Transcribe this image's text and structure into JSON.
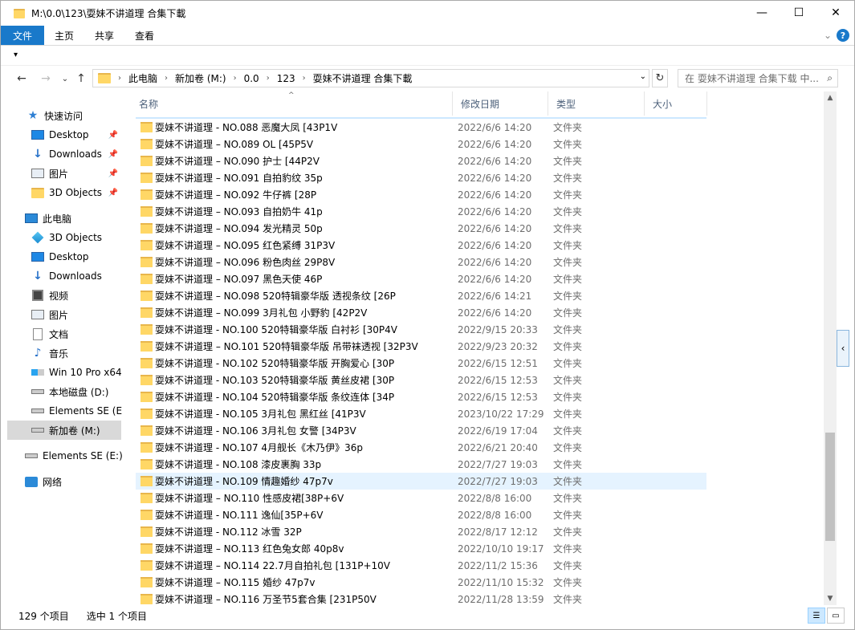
{
  "window": {
    "title": "M:\\0.0\\123\\耍妹不讲道理 合集下載",
    "minimize": "—",
    "maximize": "☐",
    "close": "✕"
  },
  "ribbon": {
    "tabs": [
      "文件",
      "主页",
      "共享",
      "查看"
    ],
    "expand": "⌄",
    "help": "?"
  },
  "qat": {
    "dropdown": "▾"
  },
  "address": {
    "crumbs": [
      "此电脑",
      "新加卷 (M:)",
      "0.0",
      "123",
      "耍妹不讲道理 合集下載"
    ],
    "search_placeholder": "在 耍妹不讲道理 合集下载 中..."
  },
  "nav": {
    "items": [
      {
        "label": "快速访问",
        "icon": "star-icon"
      },
      {
        "label": "Desktop",
        "icon": "desktop-icon",
        "pinned": true
      },
      {
        "label": "Downloads",
        "icon": "downloads-icon",
        "pinned": true
      },
      {
        "label": "图片",
        "icon": "pictures-icon",
        "pinned": true
      },
      {
        "label": "3D Objects",
        "icon": "folder-icon",
        "pinned": true
      },
      {
        "label": "此电脑",
        "icon": "this-pc-icon"
      },
      {
        "label": "3D Objects",
        "icon": "objects-3d-icon"
      },
      {
        "label": "Desktop",
        "icon": "desktop-icon"
      },
      {
        "label": "Downloads",
        "icon": "downloads-icon"
      },
      {
        "label": "视频",
        "icon": "videos-icon"
      },
      {
        "label": "图片",
        "icon": "pictures-icon"
      },
      {
        "label": "文档",
        "icon": "documents-icon"
      },
      {
        "label": "音乐",
        "icon": "music-icon"
      },
      {
        "label": "Win 10 Pro x64",
        "icon": "windows-drive-icon"
      },
      {
        "label": "本地磁盘 (D:)",
        "icon": "drive-icon"
      },
      {
        "label": "Elements SE (E:",
        "icon": "drive-icon"
      },
      {
        "label": "新加卷 (M:)",
        "icon": "drive-icon",
        "selected": true
      },
      {
        "label": "Elements SE (E:)",
        "icon": "drive-icon"
      },
      {
        "label": "网络",
        "icon": "network-icon"
      }
    ]
  },
  "columns": [
    "名称",
    "修改日期",
    "类型",
    "大小"
  ],
  "files": [
    {
      "name": "耍妹不讲道理 - NO.088 恶魔大凤 [43P1V",
      "date": "2022/6/6 14:20",
      "type": "文件夹"
    },
    {
      "name": "耍妹不讲道理 – NO.089 OL [45P5V",
      "date": "2022/6/6 14:20",
      "type": "文件夹"
    },
    {
      "name": "耍妹不讲道理 – NO.090 护士 [44P2V",
      "date": "2022/6/6 14:20",
      "type": "文件夹"
    },
    {
      "name": "耍妹不讲道理 – NO.091 自拍豹纹 35p",
      "date": "2022/6/6 14:20",
      "type": "文件夹"
    },
    {
      "name": "耍妹不讲道理 – NO.092 牛仔裤 [28P",
      "date": "2022/6/6 14:20",
      "type": "文件夹"
    },
    {
      "name": "耍妹不讲道理 – NO.093 自拍奶牛 41p",
      "date": "2022/6/6 14:20",
      "type": "文件夹"
    },
    {
      "name": "耍妹不讲道理 – NO.094 发光精灵 50p",
      "date": "2022/6/6 14:20",
      "type": "文件夹"
    },
    {
      "name": "耍妹不讲道理 – NO.095 红色紧缚 31P3V",
      "date": "2022/6/6 14:20",
      "type": "文件夹"
    },
    {
      "name": "耍妹不讲道理 – NO.096 粉色肉丝 29P8V",
      "date": "2022/6/6 14:20",
      "type": "文件夹"
    },
    {
      "name": "耍妹不讲道理 – NO.097 黑色天使 46P",
      "date": "2022/6/6 14:20",
      "type": "文件夹"
    },
    {
      "name": "耍妹不讲道理 – NO.098 520特辑豪华版 透视条纹 [26P",
      "date": "2022/6/6 14:21",
      "type": "文件夹"
    },
    {
      "name": "耍妹不讲道理 – NO.099 3月礼包 小野豹 [42P2V",
      "date": "2022/6/6 14:20",
      "type": "文件夹"
    },
    {
      "name": "耍妹不讲道理 - NO.100 520特辑豪华版 白衬衫 [30P4V",
      "date": "2022/9/15 20:33",
      "type": "文件夹"
    },
    {
      "name": "耍妹不讲道理 – NO.101 520特辑豪华版 吊带袜透视 [32P3V",
      "date": "2022/9/23 20:32",
      "type": "文件夹"
    },
    {
      "name": "耍妹不讲道理 - NO.102 520特辑豪华版 开胸爱心 [30P",
      "date": "2022/6/15 12:51",
      "type": "文件夹"
    },
    {
      "name": "耍妹不讲道理 - NO.103 520特辑豪华版 黄丝皮裙 [30P",
      "date": "2022/6/15 12:53",
      "type": "文件夹"
    },
    {
      "name": "耍妹不讲道理 - NO.104 520特辑豪华版 条纹连体 [34P",
      "date": "2022/6/15 12:53",
      "type": "文件夹"
    },
    {
      "name": "耍妹不讲道理 - NO.105 3月礼包 黑红丝 [41P3V",
      "date": "2023/10/22 17:29",
      "type": "文件夹"
    },
    {
      "name": "耍妹不讲道理 - NO.106 3月礼包 女警 [34P3V",
      "date": "2022/6/19 17:04",
      "type": "文件夹"
    },
    {
      "name": "耍妹不讲道理 - NO.107 4月舰长《木乃伊》36p",
      "date": "2022/6/21 20:40",
      "type": "文件夹"
    },
    {
      "name": "耍妹不讲道理 - NO.108 漆皮裹胸 33p",
      "date": "2022/7/27 19:03",
      "type": "文件夹"
    },
    {
      "name": "耍妹不讲道理 - NO.109 情趣婚纱 47p7v",
      "date": "2022/7/27 19:03",
      "type": "文件夹",
      "hover": true
    },
    {
      "name": "耍妹不讲道理 – NO.110 性感皮裙[38P+6V",
      "date": "2022/8/8 16:00",
      "type": "文件夹"
    },
    {
      "name": "耍妹不讲道理 - NO.111 逸仙[35P+6V",
      "date": "2022/8/8 16:00",
      "type": "文件夹"
    },
    {
      "name": "耍妹不讲道理 - NO.112 冰雪 32P",
      "date": "2022/8/17 12:12",
      "type": "文件夹"
    },
    {
      "name": "耍妹不讲道理 – NO.113 红色兔女郎 40p8v",
      "date": "2022/10/10 19:17",
      "type": "文件夹"
    },
    {
      "name": "耍妹不讲道理 – NO.114 22.7月自拍礼包 [131P+10V",
      "date": "2022/11/2 15:36",
      "type": "文件夹"
    },
    {
      "name": "耍妹不讲道理 – NO.115 婚纱 47p7v",
      "date": "2022/11/10 15:32",
      "type": "文件夹"
    },
    {
      "name": "耍妹不讲道理 – NO.116 万圣节5套合集 [231P50V",
      "date": "2022/11/28 13:59",
      "type": "文件夹"
    }
  ],
  "status": {
    "count": "129 个项目",
    "selected": "选中 1 个项目"
  }
}
